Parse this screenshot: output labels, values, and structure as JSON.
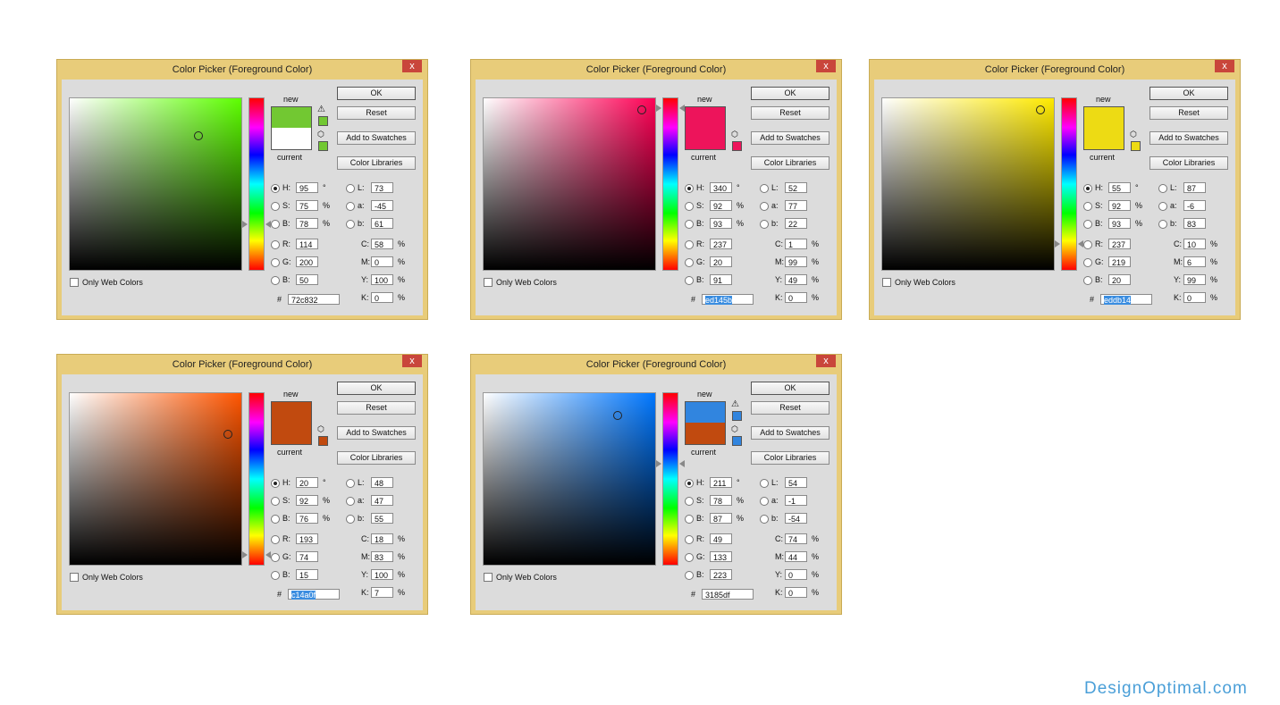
{
  "watermark": "DesignOptimal.com",
  "dialogs": [
    {
      "title": "Color Picker (Foreground Color)",
      "close": "x",
      "new_label": "new",
      "current_label": "current",
      "buttons": {
        "ok": "OK",
        "reset": "Reset",
        "add_to_swatches": "Add to Swatches",
        "color_libraries": "Color Libraries"
      },
      "only_web_colors": "Only Web Colors",
      "new_color": "#72c832",
      "current_color": "#ffffff",
      "hue_color": "#5dff00",
      "out_of_gamut_warning": true,
      "cursor": {
        "saturation": 0.75,
        "brightness": 0.78
      },
      "hue_fraction": 0.736,
      "fields": {
        "H": {
          "label": "H:",
          "value": "95",
          "unit": "°"
        },
        "S": {
          "label": "S:",
          "value": "75",
          "unit": "%"
        },
        "B": {
          "label": "B:",
          "value": "78",
          "unit": "%"
        },
        "R": {
          "label": "R:",
          "value": "114"
        },
        "G": {
          "label": "G:",
          "value": "200"
        },
        "Bl": {
          "label": "B:",
          "value": "50"
        },
        "L": {
          "label": "L:",
          "value": "73"
        },
        "a": {
          "label": "a:",
          "value": "-45"
        },
        "b": {
          "label": "b:",
          "value": "61"
        },
        "C": {
          "label": "C:",
          "value": "58",
          "unit": "%"
        },
        "M": {
          "label": "M:",
          "value": "0",
          "unit": "%"
        },
        "Y": {
          "label": "Y:",
          "value": "100",
          "unit": "%"
        },
        "K": {
          "label": "K:",
          "value": "0",
          "unit": "%"
        }
      },
      "hex_label": "#",
      "hex": "72c832",
      "hex_selected": false
    },
    {
      "title": "Color Picker (Foreground Color)",
      "close": "x",
      "new_label": "new",
      "current_label": "current",
      "buttons": {
        "ok": "OK",
        "reset": "Reset",
        "add_to_swatches": "Add to Swatches",
        "color_libraries": "Color Libraries"
      },
      "only_web_colors": "Only Web Colors",
      "new_color": "#ed145b",
      "current_color": "#ed145b",
      "hue_color": "#ff0055",
      "out_of_gamut_warning": false,
      "cursor": {
        "saturation": 0.92,
        "brightness": 0.93
      },
      "hue_fraction": 0.056,
      "fields": {
        "H": {
          "label": "H:",
          "value": "340",
          "unit": "°"
        },
        "S": {
          "label": "S:",
          "value": "92",
          "unit": "%"
        },
        "B": {
          "label": "B:",
          "value": "93",
          "unit": "%"
        },
        "R": {
          "label": "R:",
          "value": "237"
        },
        "G": {
          "label": "G:",
          "value": "20"
        },
        "Bl": {
          "label": "B:",
          "value": "91"
        },
        "L": {
          "label": "L:",
          "value": "52"
        },
        "a": {
          "label": "a:",
          "value": "77"
        },
        "b": {
          "label": "b:",
          "value": "22"
        },
        "C": {
          "label": "C:",
          "value": "1",
          "unit": "%"
        },
        "M": {
          "label": "M:",
          "value": "99",
          "unit": "%"
        },
        "Y": {
          "label": "Y:",
          "value": "49",
          "unit": "%"
        },
        "K": {
          "label": "K:",
          "value": "0",
          "unit": "%"
        }
      },
      "hex_label": "#",
      "hex": "ed145b",
      "hex_selected": true
    },
    {
      "title": "Color Picker (Foreground Color)",
      "close": "x",
      "new_label": "new",
      "current_label": "current",
      "buttons": {
        "ok": "OK",
        "reset": "Reset",
        "add_to_swatches": "Add to Swatches",
        "color_libraries": "Color Libraries"
      },
      "only_web_colors": "Only Web Colors",
      "new_color": "#eddb14",
      "current_color": "#eddb14",
      "hue_color": "#ffea00",
      "out_of_gamut_warning": false,
      "cursor": {
        "saturation": 0.92,
        "brightness": 0.93
      },
      "hue_fraction": 0.847,
      "fields": {
        "H": {
          "label": "H:",
          "value": "55",
          "unit": "°"
        },
        "S": {
          "label": "S:",
          "value": "92",
          "unit": "%"
        },
        "B": {
          "label": "B:",
          "value": "93",
          "unit": "%"
        },
        "R": {
          "label": "R:",
          "value": "237"
        },
        "G": {
          "label": "G:",
          "value": "219"
        },
        "Bl": {
          "label": "B:",
          "value": "20"
        },
        "L": {
          "label": "L:",
          "value": "87"
        },
        "a": {
          "label": "a:",
          "value": "-6"
        },
        "b": {
          "label": "b:",
          "value": "83"
        },
        "C": {
          "label": "C:",
          "value": "10",
          "unit": "%"
        },
        "M": {
          "label": "M:",
          "value": "6",
          "unit": "%"
        },
        "Y": {
          "label": "Y:",
          "value": "99",
          "unit": "%"
        },
        "K": {
          "label": "K:",
          "value": "0",
          "unit": "%"
        }
      },
      "hex_label": "#",
      "hex": "eddb14",
      "hex_selected": true
    },
    {
      "title": "Color Picker (Foreground Color)",
      "close": "x",
      "new_label": "new",
      "current_label": "current",
      "buttons": {
        "ok": "OK",
        "reset": "Reset",
        "add_to_swatches": "Add to Swatches",
        "color_libraries": "Color Libraries"
      },
      "only_web_colors": "Only Web Colors",
      "new_color": "#c14a0f",
      "current_color": "#c14a0f",
      "hue_color": "#ff5500",
      "out_of_gamut_warning": false,
      "cursor": {
        "saturation": 0.92,
        "brightness": 0.76
      },
      "hue_fraction": 0.944,
      "fields": {
        "H": {
          "label": "H:",
          "value": "20",
          "unit": "°"
        },
        "S": {
          "label": "S:",
          "value": "92",
          "unit": "%"
        },
        "B": {
          "label": "B:",
          "value": "76",
          "unit": "%"
        },
        "R": {
          "label": "R:",
          "value": "193"
        },
        "G": {
          "label": "G:",
          "value": "74"
        },
        "Bl": {
          "label": "B:",
          "value": "15"
        },
        "L": {
          "label": "L:",
          "value": "48"
        },
        "a": {
          "label": "a:",
          "value": "47"
        },
        "b": {
          "label": "b:",
          "value": "55"
        },
        "C": {
          "label": "C:",
          "value": "18",
          "unit": "%"
        },
        "M": {
          "label": "M:",
          "value": "83",
          "unit": "%"
        },
        "Y": {
          "label": "Y:",
          "value": "100",
          "unit": "%"
        },
        "K": {
          "label": "K:",
          "value": "7",
          "unit": "%"
        }
      },
      "hex_label": "#",
      "hex": "c14a0f",
      "hex_selected": true
    },
    {
      "title": "Color Picker (Foreground Color)",
      "close": "x",
      "new_label": "new",
      "current_label": "current",
      "buttons": {
        "ok": "OK",
        "reset": "Reset",
        "add_to_swatches": "Add to Swatches",
        "color_libraries": "Color Libraries"
      },
      "only_web_colors": "Only Web Colors",
      "new_color": "#3185df",
      "current_color": "#c14a0f",
      "hue_color": "#0077ff",
      "out_of_gamut_warning": true,
      "cursor": {
        "saturation": 0.78,
        "brightness": 0.87
      },
      "hue_fraction": 0.414,
      "fields": {
        "H": {
          "label": "H:",
          "value": "211",
          "unit": "°"
        },
        "S": {
          "label": "S:",
          "value": "78",
          "unit": "%"
        },
        "B": {
          "label": "B:",
          "value": "87",
          "unit": "%"
        },
        "R": {
          "label": "R:",
          "value": "49"
        },
        "G": {
          "label": "G:",
          "value": "133"
        },
        "Bl": {
          "label": "B:",
          "value": "223"
        },
        "L": {
          "label": "L:",
          "value": "54"
        },
        "a": {
          "label": "a:",
          "value": "-1"
        },
        "b": {
          "label": "b:",
          "value": "-54"
        },
        "C": {
          "label": "C:",
          "value": "74",
          "unit": "%"
        },
        "M": {
          "label": "M:",
          "value": "44",
          "unit": "%"
        },
        "Y": {
          "label": "Y:",
          "value": "0",
          "unit": "%"
        },
        "K": {
          "label": "K:",
          "value": "0",
          "unit": "%"
        }
      },
      "hex_label": "#",
      "hex": "3185df",
      "hex_selected": false
    }
  ]
}
